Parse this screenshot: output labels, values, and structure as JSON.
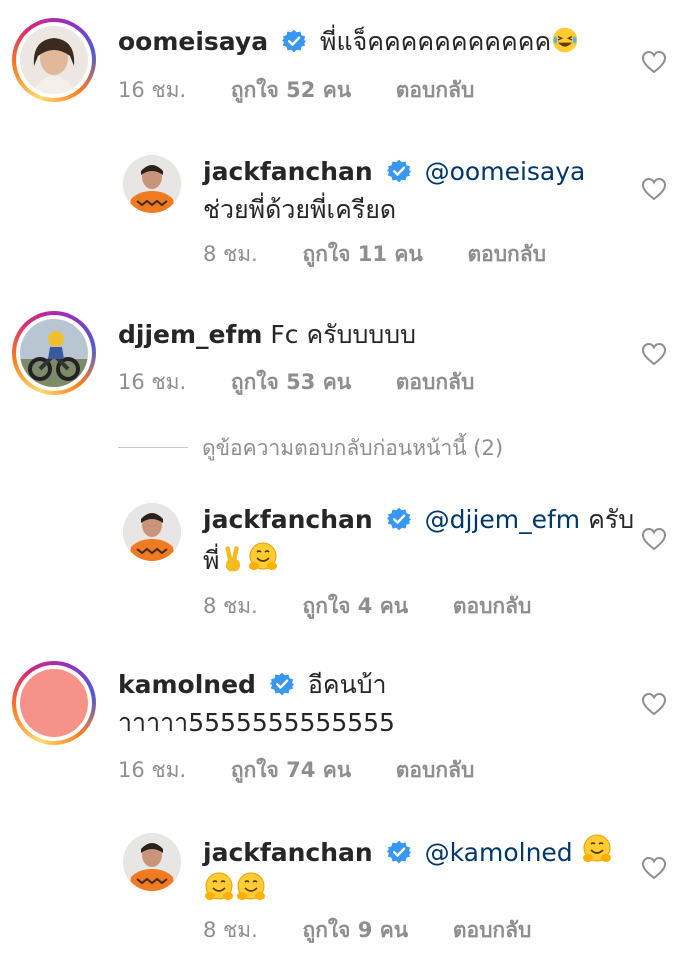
{
  "comments": [
    {
      "username": "oomeisaya",
      "verified": true,
      "mention": "",
      "text_line1": "พี่แจ็คคคคคคคคคคค",
      "text_line2": "",
      "time": "16 ชม.",
      "likes": "ถูกใจ 52 คน",
      "reply": "ตอบกลับ"
    },
    {
      "username": "jackfanchan",
      "verified": true,
      "mention": "@oomeisaya",
      "text_line1": "",
      "text_line2": "ช่วยพี่ด้วยพี่เครียด",
      "time": "8 ชม.",
      "likes": "ถูกใจ 11 คน",
      "reply": "ตอบกลับ"
    },
    {
      "username": "djjem_efm",
      "verified": false,
      "mention": "",
      "text_line1": "Fc ครับบบบบ",
      "text_line2": "",
      "time": "16 ชม.",
      "likes": "ถูกใจ 53 คน",
      "reply": "ตอบกลับ"
    },
    {
      "username": "jackfanchan",
      "verified": true,
      "mention": "@djjem_efm",
      "text_line1": "ครับ",
      "text_line2": "พี่",
      "time": "8 ชม.",
      "likes": "ถูกใจ 4 คน",
      "reply": "ตอบกลับ"
    },
    {
      "username": "kamolned",
      "verified": true,
      "mention": "",
      "text_line1": "อีคนบ้า",
      "text_line2": "าาาาา5555555555555",
      "time": "16 ชม.",
      "likes": "ถูกใจ 74 คน",
      "reply": "ตอบกลับ"
    },
    {
      "username": "jackfanchan",
      "verified": true,
      "mention": "@kamolned",
      "text_line1": "",
      "text_line2": "",
      "time": "8 ชม.",
      "likes": "ถูกใจ 9 คน",
      "reply": "ตอบกลับ"
    }
  ],
  "view_previous_replies": "ดูข้อความตอบกลับก่อนหน้านี้ (2)",
  "icons": {
    "verified": "verified-badge-icon",
    "heart": "heart-outline-icon"
  },
  "colors": {
    "verified": "#3897f0",
    "meta": "#8e8e8e",
    "mention": "#00376b",
    "text": "#262626"
  }
}
